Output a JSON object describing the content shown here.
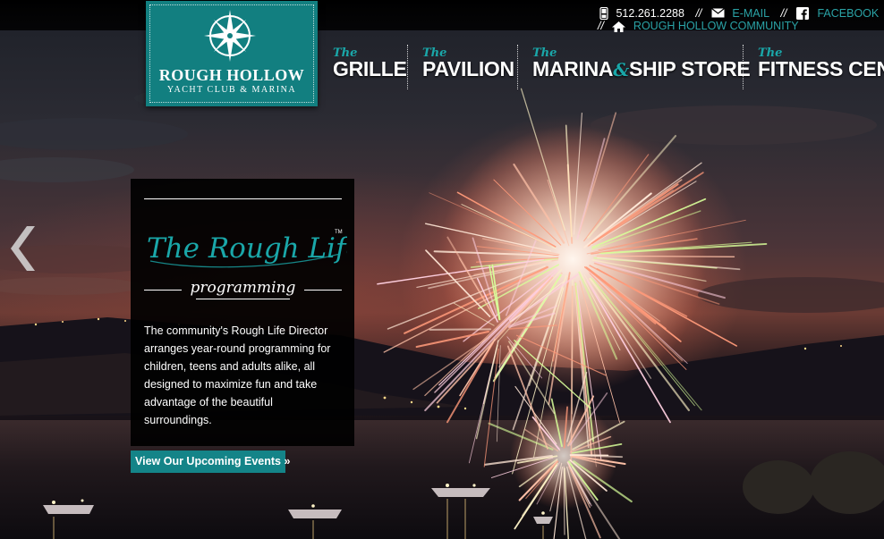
{
  "brand": {
    "logo_title": "ROUGH HOLLOW",
    "logo_subtitle": "YACHT CLUB & MARINA",
    "colors": {
      "teal": "#127f80",
      "accent_teal": "#1aa7a9",
      "link_teal": "#2aa3a6"
    }
  },
  "contact": {
    "phone": "512.261.2288",
    "separator": "//",
    "email_label": "E-MAIL",
    "facebook_label": "FACEBOOK",
    "community_label": "ROUGH HOLLOW COMMUNITY",
    "icons": [
      "phone-icon",
      "envelope-icon",
      "facebook-icon",
      "home-icon"
    ]
  },
  "nav": {
    "items": [
      {
        "prefix": "The",
        "label": "GRILLE"
      },
      {
        "prefix": "The",
        "label": "PAVILION"
      },
      {
        "prefix": "The",
        "label": "MARINA",
        "amp": "&",
        "label2": "SHIP STORE"
      },
      {
        "prefix": "The",
        "label": "FITNESS CENT"
      }
    ]
  },
  "slider": {
    "prev_icon": "chevron-left-icon"
  },
  "feature": {
    "script_title": "The Rough Life",
    "trademark": "TM",
    "subtitle": "programming",
    "description": "The community's Rough Life Director arranges year-round programming for children, teens and adults alike, all designed to maximize fun and take advantage of the beautiful surroundings.",
    "cta_label": "View Our Upcoming Events »"
  }
}
